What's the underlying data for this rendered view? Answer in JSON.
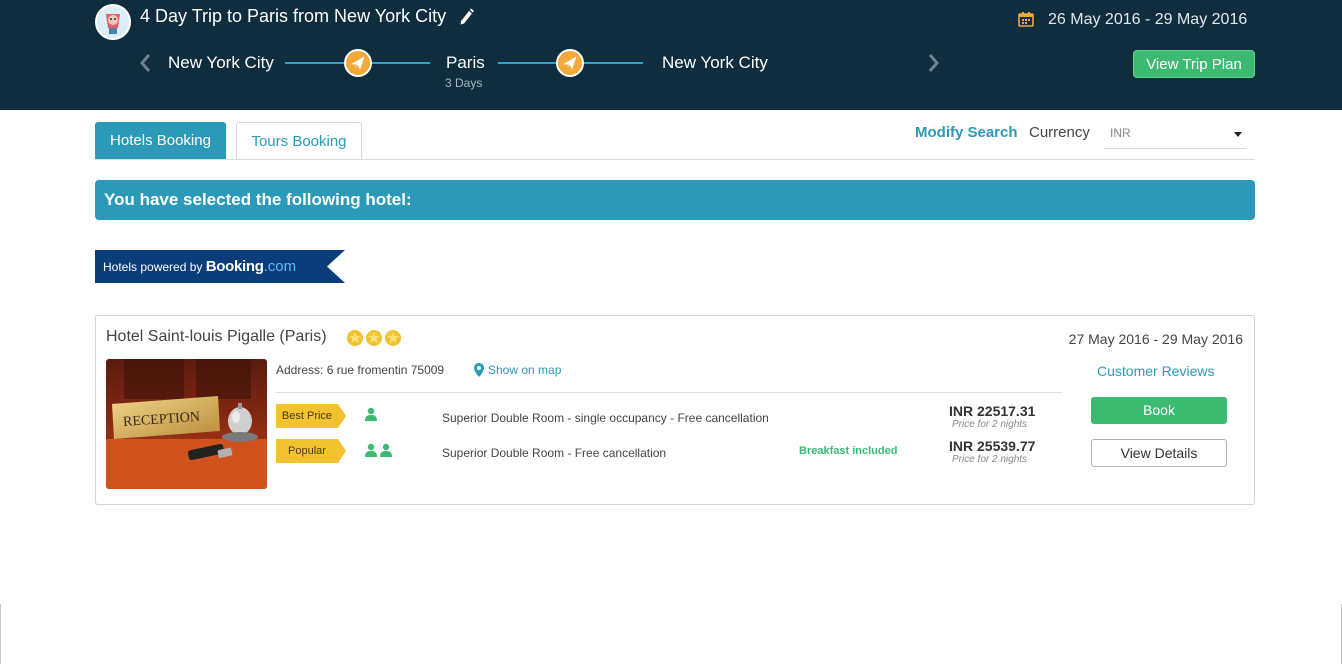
{
  "header": {
    "trip_title": "4 Day Trip to Paris from New York City",
    "dates": "26 May 2016 - 29 May 2016",
    "view_trip_plan": "View Trip Plan",
    "route": {
      "origin": "New York City",
      "destination": "Paris",
      "destination_duration": "3 Days",
      "return": "New York City"
    }
  },
  "tabs": [
    {
      "label": "Hotels Booking",
      "active": true
    },
    {
      "label": "Tours Booking",
      "active": false
    }
  ],
  "toolbar": {
    "modify_search": "Modify Search",
    "currency_label": "Currency",
    "currency_value": "INR"
  },
  "banner": {
    "text": "You have selected the following hotel:"
  },
  "powered_by": {
    "prefix": "Hotels powered by",
    "brand": "Booking",
    "brand_suffix": ".com"
  },
  "hotel": {
    "name": "Hotel Saint-louis Pigalle (Paris)",
    "stars": 3,
    "dates": "27 May 2016 - 29 May 2016",
    "address": "Address: 6 rue fromentin 75009",
    "show_on_map": "Show on map",
    "image_sign_text": "RECEPTION",
    "customer_reviews": "Customer Reviews",
    "book_label": "Book",
    "view_details_label": "View Details",
    "rooms": [
      {
        "tag": "Best Price",
        "occupancy": 1,
        "description": "Superior Double Room - single occupancy - Free cancellation",
        "extra": "",
        "price": "INR 22517.31",
        "price_note": "Price for 2 nights"
      },
      {
        "tag": "Popular",
        "occupancy": 2,
        "description": "Superior Double Room - Free cancellation",
        "extra": "Breakfast included",
        "price": "INR 25539.77",
        "price_note": "Price for 2 nights"
      }
    ]
  },
  "colors": {
    "header_bg": "#0f2d3d",
    "accent": "#2a9ab8",
    "success": "#3dba71",
    "tag_yellow": "#f2c230",
    "plane_orange": "#f3a93a",
    "booking_navy": "#0a3d7a"
  }
}
